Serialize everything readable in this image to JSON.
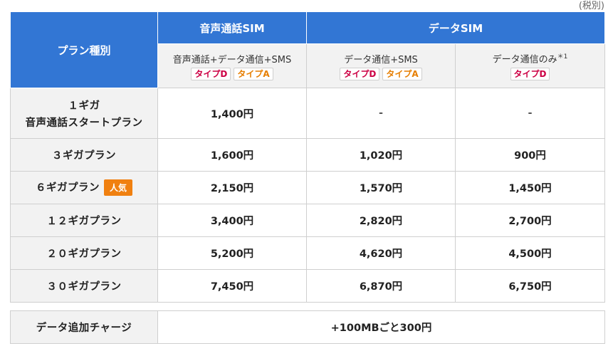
{
  "tax_note": "(税別)",
  "header": {
    "plan_type": "プラン種別",
    "voice_sim": "音声通話SIM",
    "data_sim": "データSIM",
    "col1_label": "音声通話+データ通信+SMS",
    "col2_label": "データ通信+SMS",
    "col3_label": "データ通信のみ",
    "col3_sup": "＊1",
    "type_d": "タイプD",
    "type_a": "タイプA"
  },
  "popular_badge": "人気",
  "rows": [
    {
      "plan_line1": "１ギガ",
      "plan_line2": "音声通話スタートプラン",
      "voice": "1,400円",
      "data_sms": "-",
      "data_only": "-"
    },
    {
      "plan": "３ギガプラン",
      "voice": "1,600円",
      "data_sms": "1,020円",
      "data_only": "900円"
    },
    {
      "plan": "６ギガプラン",
      "voice": "2,150円",
      "data_sms": "1,570円",
      "data_only": "1,450円"
    },
    {
      "plan": "１２ギガプラン",
      "voice": "3,400円",
      "data_sms": "2,820円",
      "data_only": "2,700円"
    },
    {
      "plan": "２０ギガプラン",
      "voice": "5,200円",
      "data_sms": "4,620円",
      "data_only": "4,500円"
    },
    {
      "plan": "３０ギガプラン",
      "voice": "7,450円",
      "data_sms": "6,870円",
      "data_only": "6,750円"
    }
  ],
  "charge": {
    "label": "データ追加チャージ",
    "value": "+100MBごと300円"
  }
}
